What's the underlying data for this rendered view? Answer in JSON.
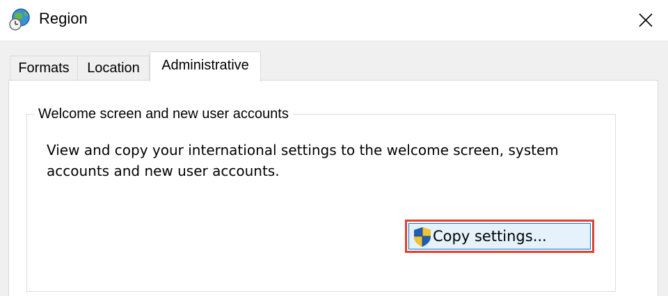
{
  "window": {
    "title": "Region",
    "icon": "globe-clock-icon",
    "close_icon": "close-icon"
  },
  "tabs": [
    {
      "label": "Formats",
      "selected": false
    },
    {
      "label": "Location",
      "selected": false
    },
    {
      "label": "Administrative",
      "selected": true
    }
  ],
  "group": {
    "title": "Welcome screen and new user accounts",
    "description": "View and copy your international settings to the welcome screen, system accounts and new user accounts.",
    "copy_button": {
      "label": "Copy settings...",
      "icon": "uac-shield-icon"
    }
  },
  "colors": {
    "highlight_outline": "#e0412f",
    "button_focus_border": "#0078d7",
    "button_bg": "#e5f1fb"
  }
}
